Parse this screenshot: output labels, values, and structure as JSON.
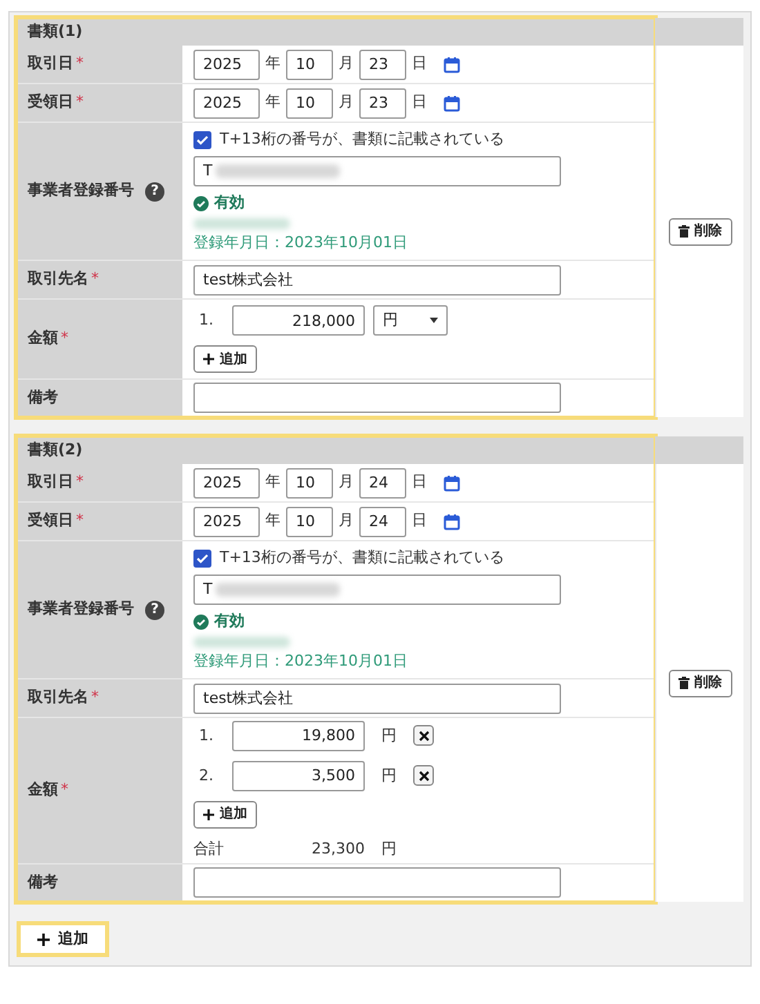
{
  "documents": [
    {
      "title": "書類(1)",
      "highlighted": true,
      "trade_date": {
        "label": "取引日",
        "required_mark": "*",
        "year": "2025",
        "year_unit": "年",
        "month": "10",
        "month_unit": "月",
        "day": "23",
        "day_unit": "日"
      },
      "receipt_date": {
        "label": "受領日",
        "required_mark": "*",
        "year": "2025",
        "year_unit": "年",
        "month": "10",
        "month_unit": "月",
        "day": "23",
        "day_unit": "日"
      },
      "registration": {
        "label": "事業者登録番号",
        "help": "?",
        "checkbox_label": "T+13桁の番号が、書類に記載されている",
        "checked": true,
        "value": "T",
        "status": "有効",
        "registered_on": "登録年月日：2023年10月01日"
      },
      "partner": {
        "label": "取引先名",
        "required_mark": "*",
        "value": "test株式会社"
      },
      "amount": {
        "label": "金額",
        "required_mark": "*",
        "items": [
          {
            "kind": "select",
            "index": "1.",
            "value": "218,000",
            "currency": "円"
          }
        ],
        "add_button": "追加"
      },
      "remarks": {
        "label": "備考"
      },
      "delete_button": "削除"
    },
    {
      "title": "書類(2)",
      "highlighted": true,
      "trade_date": {
        "label": "取引日",
        "required_mark": "*",
        "year": "2025",
        "year_unit": "年",
        "month": "10",
        "month_unit": "月",
        "day": "24",
        "day_unit": "日"
      },
      "receipt_date": {
        "label": "受領日",
        "required_mark": "*",
        "year": "2025",
        "year_unit": "年",
        "month": "10",
        "month_unit": "月",
        "day": "24",
        "day_unit": "日"
      },
      "registration": {
        "label": "事業者登録番号",
        "help": "?",
        "checkbox_label": "T+13桁の番号が、書類に記載されている",
        "checked": true,
        "value": "T",
        "status": "有効",
        "registered_on": "登録年月日：2023年10月01日"
      },
      "partner": {
        "label": "取引先名",
        "required_mark": "*",
        "value": "test株式会社"
      },
      "amount": {
        "label": "金額",
        "required_mark": "*",
        "items": [
          {
            "kind": "fixed",
            "index": "1.",
            "value": "19,800",
            "currency": "円"
          },
          {
            "kind": "fixed",
            "index": "2.",
            "value": "3,500",
            "currency": "円"
          }
        ],
        "add_button": "追加",
        "total": {
          "label": "合計",
          "value": "23,300",
          "currency": "円"
        }
      },
      "remarks": {
        "label": "備考"
      },
      "delete_button": "削除"
    }
  ],
  "add_document_button": {
    "label": "追加",
    "highlighted": true
  }
}
